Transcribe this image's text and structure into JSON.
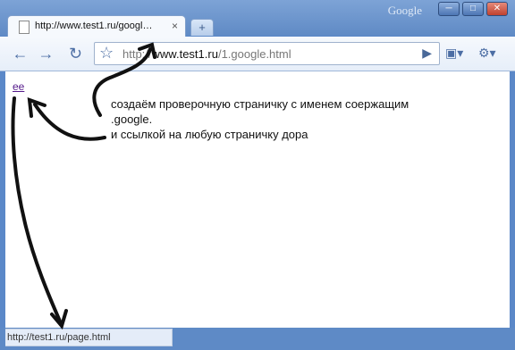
{
  "window": {
    "brand": "Google",
    "controls": [
      "─",
      "□",
      "✕"
    ]
  },
  "tab": {
    "title": "http://www.test1.ru/googl…",
    "close": "×"
  },
  "newtab": {
    "label": "+"
  },
  "toolbar": {
    "back": "←",
    "forward": "→",
    "reload": "↻",
    "star": "☆",
    "go": "▶",
    "page_menu": "▣▾",
    "tools_menu": "⚙▾"
  },
  "omnibox": {
    "scheme": "http://",
    "host": "www.test1.ru",
    "path": "/1.google.html"
  },
  "page": {
    "link_text": "ee"
  },
  "annotation": {
    "line1": "создаём проверочную страничку с именем соержащим",
    "line2": ".google.",
    "line3": "и ссылкой на любую страничку дора"
  },
  "status": {
    "url": "http://test1.ru/page.html"
  }
}
